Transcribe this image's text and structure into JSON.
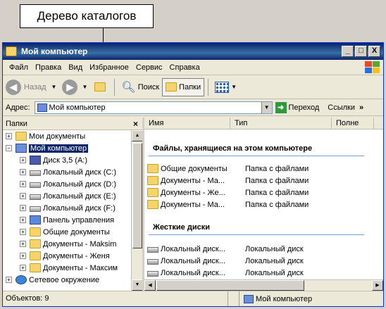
{
  "callout": {
    "label": "Дерево каталогов"
  },
  "window": {
    "title": "Мой компьютер",
    "controls": {
      "minimize": "_",
      "maximize": "□",
      "close": "X"
    }
  },
  "menu": [
    "Файл",
    "Правка",
    "Вид",
    "Избранное",
    "Сервис",
    "Справка"
  ],
  "toolbar": {
    "back": "Назад",
    "search": "Поиск",
    "folders": "Папки"
  },
  "address": {
    "label": "Адрес:",
    "value": "Мой компьютер",
    "go": "Переход",
    "links": "Ссылки"
  },
  "folders_pane": {
    "title": "Папки",
    "close": "×",
    "tree": [
      {
        "label": "Мои документы",
        "icon": "folder-icon"
      },
      {
        "label": "Мой компьютер",
        "icon": "computer-icon",
        "selected": true
      },
      {
        "label": "Диск 3,5 (A:)",
        "icon": "floppy-icon"
      },
      {
        "label": "Локальный диск (C:)",
        "icon": "drive-icon"
      },
      {
        "label": "Локальный диск (D:)",
        "icon": "drive-icon"
      },
      {
        "label": "Локальный диск (E:)",
        "icon": "drive-icon"
      },
      {
        "label": "Локальный диск (F:)",
        "icon": "drive-icon"
      },
      {
        "label": "Панель управления",
        "icon": "control-panel-icon"
      },
      {
        "label": "Общие документы",
        "icon": "folder-icon"
      },
      {
        "label": "Документы - Maksim",
        "icon": "folder-icon"
      },
      {
        "label": "Документы - Женя",
        "icon": "folder-icon"
      },
      {
        "label": "Документы - Максим",
        "icon": "folder-icon"
      },
      {
        "label": "Сетевое окружение",
        "icon": "network-icon"
      }
    ]
  },
  "content": {
    "columns": [
      "Имя",
      "Тип",
      "Полне"
    ],
    "group1": {
      "title": "Файлы, хранящиеся на этом компьютере",
      "rows": [
        {
          "name": "Общие документы",
          "type": "Папка с файлами"
        },
        {
          "name": "Документы - Ма...",
          "type": "Папка с файлами"
        },
        {
          "name": "Документы - Же...",
          "type": "Папка с файлами"
        },
        {
          "name": "Документы - Ма...",
          "type": "Папка с файлами"
        }
      ]
    },
    "group2": {
      "title": "Жесткие диски",
      "rows": [
        {
          "name": "Локальный диск...",
          "type": "Локальный диск"
        },
        {
          "name": "Локальный диск...",
          "type": "Локальный диск"
        },
        {
          "name": "Локальный диск...",
          "type": "Локальный диск"
        }
      ]
    }
  },
  "status": {
    "objects": "Объектов: 9",
    "location": "Мой компьютер"
  }
}
